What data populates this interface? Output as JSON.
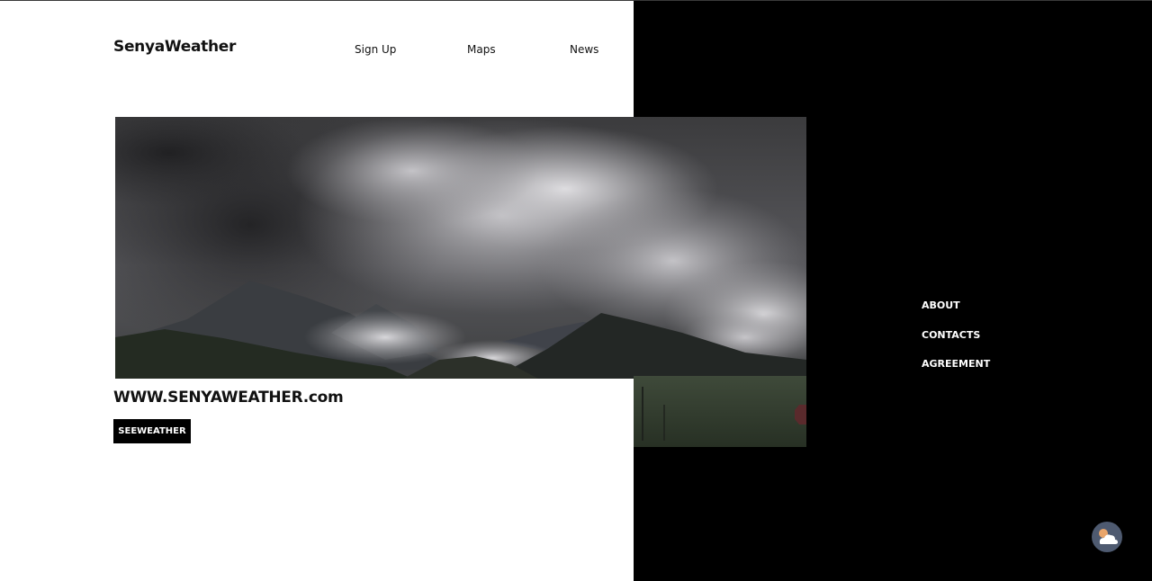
{
  "header": {
    "logo": "SenyaWeather",
    "nav": [
      {
        "label": "Sign Up"
      },
      {
        "label": "Maps"
      },
      {
        "label": "News"
      }
    ]
  },
  "hero": {
    "image_icon": "stormy-mountains-photo",
    "site_url": "WWW.SENYAWEATHER.com",
    "cta_label": "SEEWEATHER"
  },
  "side_menu": [
    {
      "label": "ABOUT"
    },
    {
      "label": "CONTACTS"
    },
    {
      "label": "AGREEMENT"
    }
  ],
  "fab": {
    "icon": "cloud-sun-icon"
  },
  "colors": {
    "left_background": "#ffffff",
    "right_background": "#000000",
    "button_background": "#000000",
    "fab_background": "#4e5a70"
  }
}
